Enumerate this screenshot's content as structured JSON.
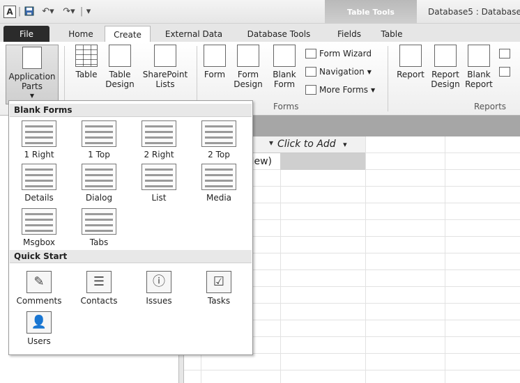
{
  "title_bar": {
    "app_icon": "A",
    "context_tab": "Table Tools",
    "window_title": "Database5 : Database"
  },
  "tabs": [
    "File",
    "Home",
    "Create",
    "External Data",
    "Database Tools",
    "Fields",
    "Table"
  ],
  "ribbon": {
    "application_parts": "Application Parts",
    "table": "Table",
    "table_design": "Table Design",
    "sharepoint_lists": "SharePoint Lists",
    "form": "Form",
    "form_design": "Form Design",
    "blank_form": "Blank Form",
    "form_wizard": "Form Wizard",
    "navigation": "Navigation",
    "more_forms": "More Forms",
    "report": "Report",
    "report_design": "Report Design",
    "blank_report": "Blank Report",
    "groups": {
      "forms": "Forms",
      "reports": "Reports"
    }
  },
  "gallery": {
    "blank_forms_header": "Blank Forms",
    "blank_forms": [
      "1 Right",
      "1 Top",
      "2 Right",
      "2 Top",
      "Details",
      "Dialog",
      "List",
      "Media",
      "Msgbox",
      "Tabs"
    ],
    "quick_start_header": "Quick Start",
    "quick_start": [
      "Comments",
      "Contacts",
      "Issues",
      "Tasks",
      "Users"
    ]
  },
  "datasheet": {
    "click_to_add": "Click to Add",
    "new_row_label": "New)"
  },
  "icons": {
    "save": "save-icon",
    "undo": "undo-icon",
    "redo": "redo-icon",
    "dropdown": "dropdown-arrow-icon"
  }
}
